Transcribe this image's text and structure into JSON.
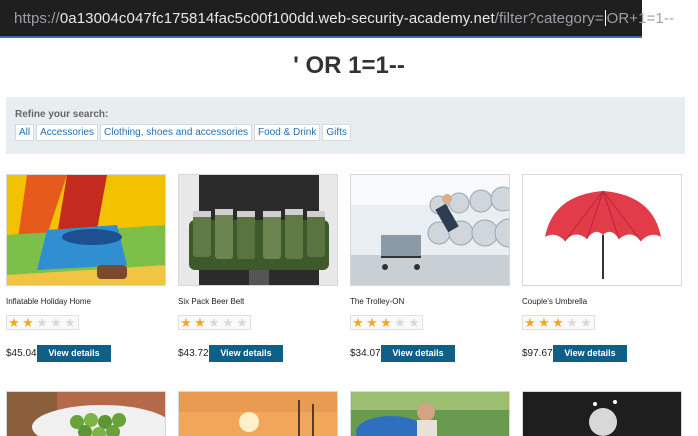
{
  "browser": {
    "url_prefix": "https://",
    "url_main": "0a13004c047fc175814fac5c00f100dd.web-security-academy.net",
    "url_path": "/filter?category=",
    "url_tail": "OR+1=1--"
  },
  "page": {
    "title": "' OR 1=1--"
  },
  "filter": {
    "label": "Refine your search:",
    "links": [
      "All",
      "Accessories",
      "Clothing, shoes and accessories",
      "Food & Drink",
      "Gifts"
    ]
  },
  "products": [
    {
      "name": "Inflatable Holiday Home",
      "rating": 2,
      "price": "$45.04",
      "button": "View details"
    },
    {
      "name": "Six Pack Beer Belt",
      "rating": 2,
      "price": "$43.72",
      "button": "View details"
    },
    {
      "name": "The Trolley-ON",
      "rating": 3,
      "price": "$34.07",
      "button": "View details"
    },
    {
      "name": "Couple's Umbrella",
      "rating": 3,
      "price": "$97.67",
      "button": "View details"
    }
  ],
  "colors": {
    "star_filled": "#f5a623",
    "star_empty": "#d9d9d9",
    "button_bg": "#0f5f86"
  }
}
